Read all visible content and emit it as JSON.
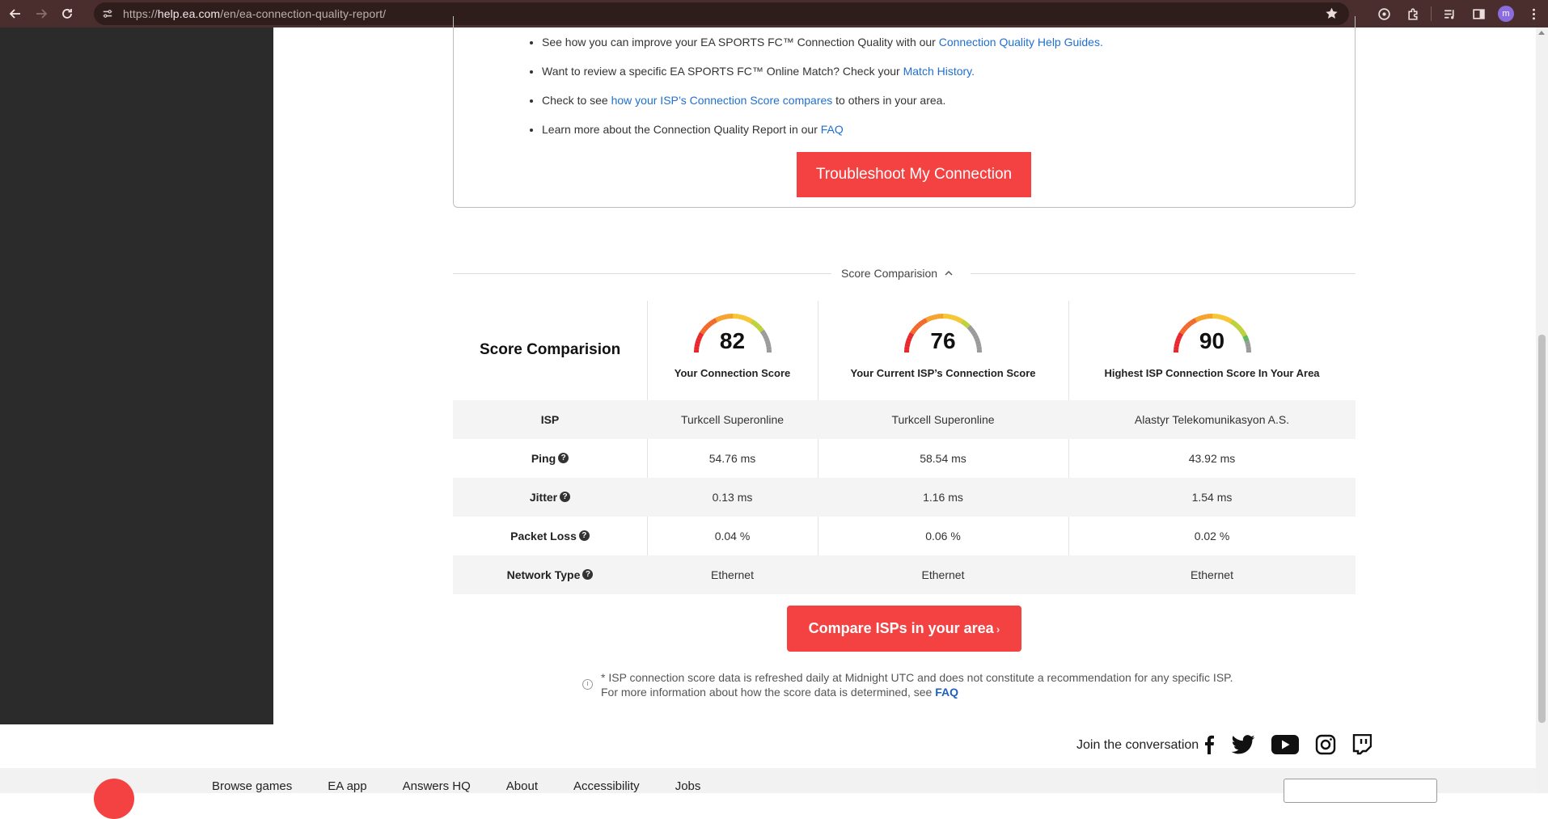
{
  "browser": {
    "url_prefix": "https://",
    "url_domain": "help.ea.com",
    "url_path": "/en/ea-connection-quality-report/",
    "profile_initial": "m"
  },
  "tips": {
    "items": [
      {
        "before": "See how you can improve your EA SPORTS FC™ Connection Quality with our ",
        "link": "Connection Quality Help Guides.",
        "after": ""
      },
      {
        "before": "Want to review a specific EA SPORTS FC™ Online Match? Check your ",
        "link": "Match History.",
        "after": ""
      },
      {
        "before": "Check to see ",
        "link": "how your ISP’s Connection Score compares",
        "after": " to others in your area."
      },
      {
        "before": "Learn more about the Connection Quality Report in our ",
        "link": "FAQ",
        "after": ""
      }
    ],
    "troubleshoot_label": "Troubleshoot My Connection"
  },
  "section": {
    "toggle_label": "Score Comparision"
  },
  "comparison": {
    "title": "Score Comparision",
    "scores": [
      {
        "value": "82",
        "label": "Your Connection Score",
        "score": 82
      },
      {
        "value": "76",
        "label": "Your Current ISP’s Connection Score",
        "score": 76
      },
      {
        "value": "90",
        "label": "Highest ISP Connection Score In Your Area",
        "score": 90
      }
    ],
    "rows": [
      {
        "label": "ISP",
        "help": false,
        "values": [
          "Turkcell Superonline",
          "Turkcell Superonline",
          "Alastyr Telekomunikasyon A.S."
        ]
      },
      {
        "label": "Ping",
        "help": true,
        "values": [
          "54.76 ms",
          "58.54 ms",
          "43.92 ms"
        ]
      },
      {
        "label": "Jitter",
        "help": true,
        "values": [
          "0.13 ms",
          "1.16 ms",
          "1.54 ms"
        ]
      },
      {
        "label": "Packet Loss",
        "help": true,
        "values": [
          "0.04 %",
          "0.06 %",
          "0.02 %"
        ]
      },
      {
        "label": "Network Type",
        "help": true,
        "values": [
          "Ethernet",
          "Ethernet",
          "Ethernet"
        ]
      }
    ],
    "compare_label": "Compare ISPs in your area",
    "compare_arrow": "›"
  },
  "note": {
    "line1": "* ISP connection score data is refreshed daily at Midnight UTC and does not constitute a recommendation for any specific ISP.",
    "line2_before": "For more information about how the score data is determined, see ",
    "line2_link": "FAQ"
  },
  "footer": {
    "join_label": "Join the conversation",
    "links": [
      "Browse games",
      "EA app",
      "Answers HQ",
      "About",
      "Accessibility",
      "Jobs"
    ]
  },
  "colors": {
    "accent": "#f44242",
    "link": "#1f6fd1",
    "chrome": "#4a2e2d"
  }
}
